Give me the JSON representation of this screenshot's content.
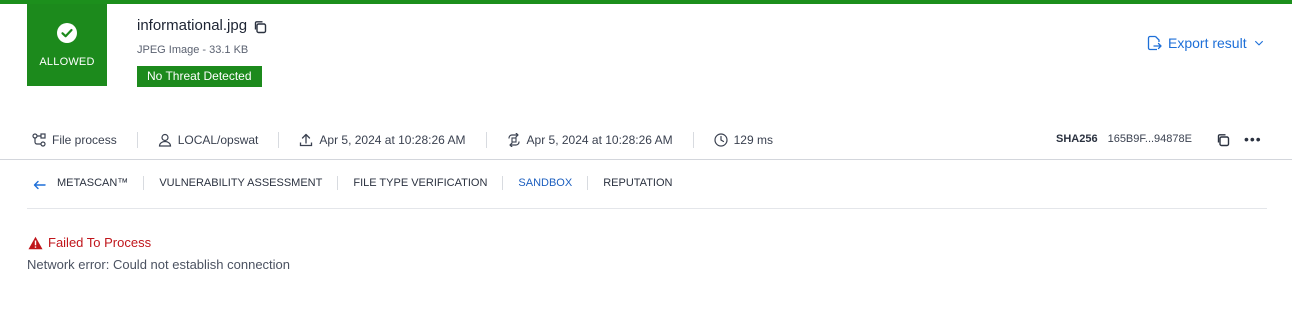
{
  "status": {
    "label": "ALLOWED",
    "color": "#1c8a1c"
  },
  "file": {
    "name": "informational.jpg",
    "meta": "JPEG Image - 33.1 KB",
    "badge": "No Threat Detected"
  },
  "export": {
    "label": "Export result"
  },
  "meta_row": {
    "process": "File process",
    "user": "LOCAL/opswat",
    "uploaded": "Apr 5, 2024 at 10:28:26 AM",
    "processed": "Apr 5, 2024 at 10:28:26 AM",
    "duration": "129 ms"
  },
  "hash": {
    "label": "SHA256",
    "value": "165B9F...94878E"
  },
  "tabs": [
    {
      "label": "METASCAN™"
    },
    {
      "label": "VULNERABILITY ASSESSMENT"
    },
    {
      "label": "FILE TYPE VERIFICATION"
    },
    {
      "label": "SANDBOX",
      "active": true
    },
    {
      "label": "REPUTATION"
    }
  ],
  "error": {
    "title": "Failed To Process",
    "message": "Network error: Could not establish connection"
  },
  "colors": {
    "accent": "#1d6fd8",
    "success": "#1c8a1c",
    "error": "#c0151b"
  }
}
